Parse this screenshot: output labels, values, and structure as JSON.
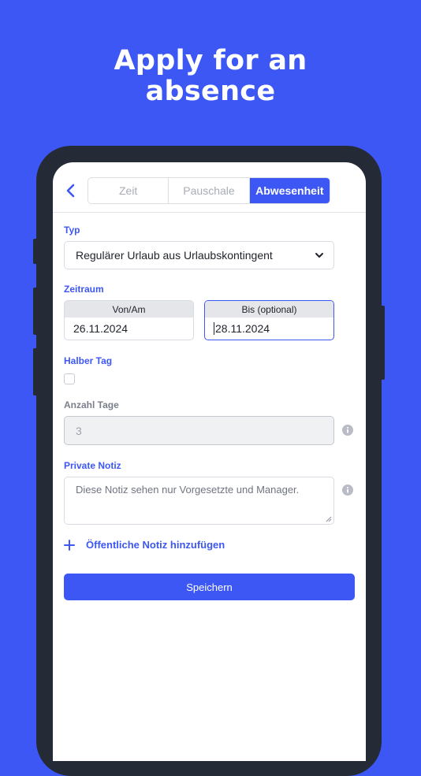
{
  "headline": {
    "line1": "Apply for an",
    "line2": "absence"
  },
  "tabs": [
    {
      "label": "Zeit",
      "active": false
    },
    {
      "label": "Pauschale",
      "active": false
    },
    {
      "label": "Abwesenheit",
      "active": true
    }
  ],
  "form": {
    "type_label": "Typ",
    "type_value": "Regulärer Urlaub aus Urlaubskontingent",
    "period_label": "Zeitraum",
    "from_label": "Von/Am",
    "from_value": "26.11.2024",
    "to_label": "Bis (optional)",
    "to_value": "28.11.2024",
    "half_day_label": "Halber Tag",
    "days_label": "Anzahl Tage",
    "days_value": "3",
    "private_note_label": "Private Notiz",
    "private_note_placeholder": "Diese Notiz sehen nur Vorgesetzte und Manager.",
    "add_public_note": "Öffentliche Notiz hinzufügen",
    "save_label": "Speichern"
  },
  "colors": {
    "accent": "#3d57f5",
    "phone_frame": "#252b36",
    "background": "#3d57f5"
  },
  "icons": {
    "back": "chevron-left-icon",
    "dropdown": "chevron-down-icon",
    "info": "info-icon",
    "add": "plus-icon"
  }
}
